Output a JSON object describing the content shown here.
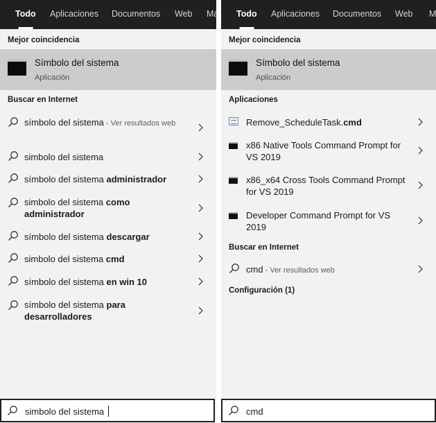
{
  "left_panel": {
    "tabs": [
      "Todo",
      "Aplicaciones",
      "Documentos",
      "Web",
      "Má"
    ],
    "best_match_title": "Mejor coincidencia",
    "best_match": {
      "name": "Símbolo del sistema",
      "type": "Aplicación"
    },
    "web_section_title": "Buscar en Internet",
    "web_results": [
      {
        "text": "símbolo del sistema",
        "bold": "",
        "hint": " - Ver resultados web"
      },
      {
        "text": "simbolo del sistema",
        "bold": "",
        "hint": ""
      },
      {
        "text": "símbolo del sistema ",
        "bold": "administrador",
        "hint": ""
      },
      {
        "text": "simbolo del sistema ",
        "bold": "como administrador",
        "hint": ""
      },
      {
        "text": "símbolo del sistema ",
        "bold": "descargar",
        "hint": ""
      },
      {
        "text": "simbolo del sistema ",
        "bold": "cmd",
        "hint": ""
      },
      {
        "text": "símbolo del sistema ",
        "bold": "en win 10",
        "hint": ""
      },
      {
        "text": "símbolo del sistema ",
        "bold": "para desarrolladores",
        "hint": ""
      }
    ],
    "search_value": "simbolo del sistema"
  },
  "right_panel": {
    "tabs": [
      "Todo",
      "Aplicaciones",
      "Documentos",
      "Web",
      "M"
    ],
    "best_match_title": "Mejor coincidencia",
    "best_match": {
      "name": "Símbolo del sistema",
      "type": "Aplicación"
    },
    "apps_section_title": "Aplicaciones",
    "apps": [
      {
        "text": "Remove_ScheduleTask.",
        "bold": "cmd",
        "icon": "script-file-icon"
      },
      {
        "text": "x86 Native Tools Command Prompt for VS 2019",
        "bold": "",
        "icon": "command-prompt-icon"
      },
      {
        "text": "x86_x64 Cross Tools Command Prompt for VS 2019",
        "bold": "",
        "icon": "command-prompt-icon"
      },
      {
        "text": "Developer Command Prompt for VS 2019",
        "bold": "",
        "icon": "command-prompt-icon"
      }
    ],
    "web_section_title": "Buscar en Internet",
    "web_result": {
      "text": "cmd",
      "hint": " - Ver resultados web"
    },
    "settings_section_title": "Configuración (1)",
    "search_value": "cmd"
  }
}
